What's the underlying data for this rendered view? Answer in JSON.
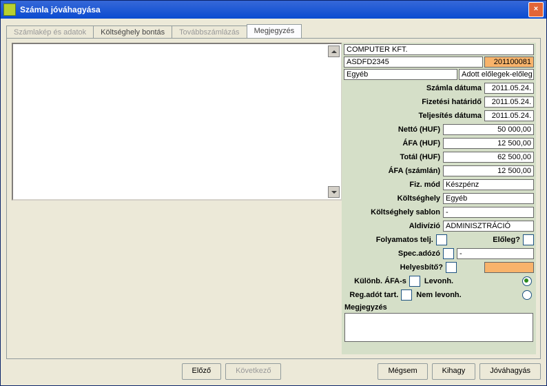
{
  "window": {
    "title": "Számla jóváhagyása"
  },
  "tabs": {
    "t0": "Számlakép és adatok",
    "t1": "Költséghely bontás",
    "t2": "Továbbszámlázás",
    "t3": "Megjegyzés"
  },
  "header": {
    "company": "COMPUTER KFT.",
    "ref": "ASDFD2345",
    "code": "201100081",
    "cat": "Egyéb",
    "note": "Adott előlegek-előleg be"
  },
  "labels": {
    "szamla_datuma": "Számla dátuma",
    "fizetesi_hatarido": "Fizetési határidő",
    "teljesites_datuma": "Teljesítés dátuma",
    "netto": "Nettó (HUF)",
    "afa": "ÁFA (HUF)",
    "total": "Totál (HUF)",
    "afa_szamlan": "ÁFA (számlán)",
    "fiz_mod": "Fiz. mód",
    "koltseghely": "Költséghely",
    "koltseghely_sablon": "Költséghely sablon",
    "aldivizio": "Aldivízió",
    "folyamatos": "Folyamatos telj.",
    "eloleg": "Előleg?",
    "spec_adozo": "Spec.adózó",
    "helyesbito": "Helyesbítő?",
    "kulonb_afa": "Különb. ÁFA-s",
    "reg_adot": "Reg.adót tart.",
    "levonh": "Levonh.",
    "nem_levonh": "Nem levonh.",
    "megjegyzes": "Megjegyzés"
  },
  "values": {
    "szamla_datuma": "2011.05.24.",
    "fizetesi_hatarido": "2011.05.24.",
    "teljesites_datuma": "2011.05.24.",
    "netto": "50 000,00",
    "afa": "12 500,00",
    "total": "62 500,00",
    "afa_szamlan": "12 500,00",
    "fiz_mod": "Készpénz",
    "koltseghely": "Egyéb",
    "koltseghely_sablon": "-",
    "aldivizio": "ADMINISZTRÁCIÓ",
    "spec_adozo_val": "-"
  },
  "footer": {
    "elozo": "Előző",
    "kovetkezo": "Következő",
    "megsem": "Mégsem",
    "kihagy": "Kihagy",
    "jovahagyas": "Jóváhagyás"
  }
}
